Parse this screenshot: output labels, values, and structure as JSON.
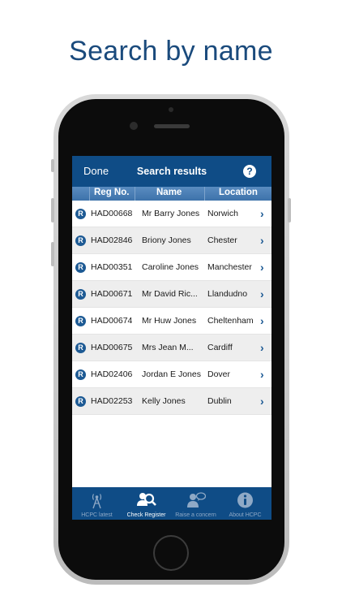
{
  "headline": "Search by name",
  "navbar": {
    "done_label": "Done",
    "title": "Search results",
    "help_glyph": "?"
  },
  "columns": {
    "reg": "Reg No.",
    "name": "Name",
    "location": "Location"
  },
  "results": [
    {
      "badge": "R",
      "reg": "HAD00668",
      "name": "Mr Barry Jones",
      "location": "Norwich"
    },
    {
      "badge": "R",
      "reg": "HAD02846",
      "name": "Briony Jones",
      "location": "Chester"
    },
    {
      "badge": "R",
      "reg": "HAD00351",
      "name": "Caroline Jones",
      "location": "Manchester"
    },
    {
      "badge": "R",
      "reg": "HAD00671",
      "name": "Mr David Ric...",
      "location": "Llandudno"
    },
    {
      "badge": "R",
      "reg": "HAD00674",
      "name": "Mr Huw Jones",
      "location": "Cheltenham"
    },
    {
      "badge": "R",
      "reg": "HAD00675",
      "name": "Mrs Jean M...",
      "location": "Cardiff"
    },
    {
      "badge": "R",
      "reg": "HAD02406",
      "name": "Jordan E Jones",
      "location": "Dover"
    },
    {
      "badge": "R",
      "reg": "HAD02253",
      "name": "Kelly Jones",
      "location": "Dublin"
    }
  ],
  "tabs": [
    {
      "label": "HCPC latest",
      "icon": "broadcast-tower-icon"
    },
    {
      "label": "Check Register",
      "icon": "people-search-icon"
    },
    {
      "label": "Raise a concern",
      "icon": "person-speech-icon"
    },
    {
      "label": "About HCPC",
      "icon": "info-icon"
    }
  ],
  "colors": {
    "brand": "#0f4c86",
    "header_gradient": "#4a80b8",
    "headline": "#1a4a7c"
  }
}
